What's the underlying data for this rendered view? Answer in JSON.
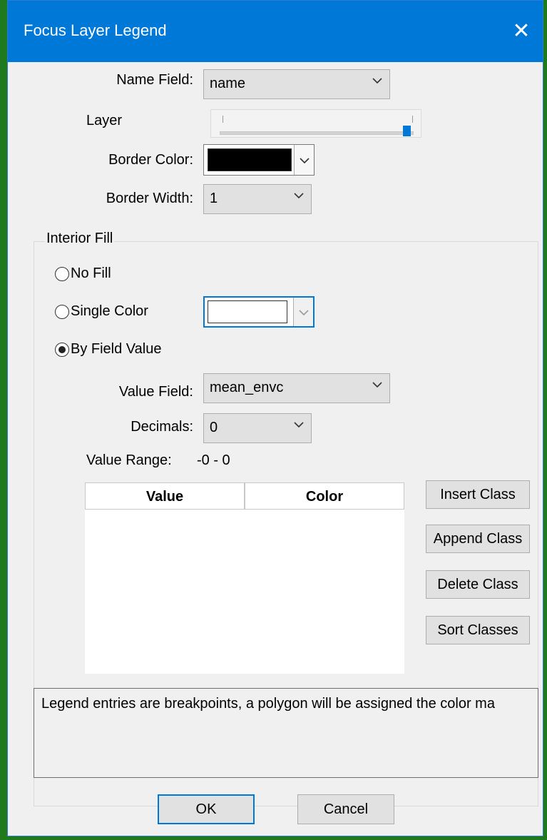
{
  "dialog": {
    "title": "Focus Layer Legend",
    "close_glyph": "✕"
  },
  "fields": {
    "name_field_label": "Name Field:",
    "name_field_value": "name",
    "layer_label": "Layer",
    "layer_slider_value": 1.0,
    "border_color_label": "Border Color:",
    "border_color_value": "#000000",
    "border_width_label": "Border Width:",
    "border_width_value": "1"
  },
  "interior_fill": {
    "group_label": "Interior Fill",
    "no_fill_label": "No Fill",
    "single_color_label": "Single Color",
    "single_color_value": "#ffffff",
    "by_field_value_label": "By Field Value",
    "selected": "by_field_value",
    "value_field_label": "Value Field:",
    "value_field_value": "mean_envc",
    "decimals_label": "Decimals:",
    "decimals_value": "0",
    "value_range_label": "Value Range:",
    "value_range_value": "-0 - 0"
  },
  "class_table": {
    "columns": [
      "Value",
      "Color"
    ],
    "rows": []
  },
  "class_buttons": {
    "insert": "Insert Class",
    "append": "Append Class",
    "delete": "Delete Class",
    "sort": "Sort Classes"
  },
  "info_text": "Legend entries are breakpoints, a polygon will be assigned the color ma",
  "footer": {
    "ok": "OK",
    "cancel": "Cancel"
  },
  "colors": {
    "accent": "#0078d7",
    "window_bg": "#f0f0f0",
    "desktop": "#1f7a1f"
  }
}
